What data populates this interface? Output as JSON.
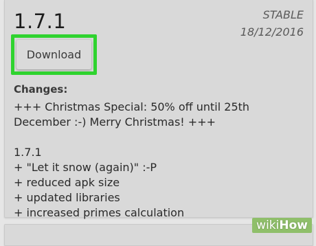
{
  "release": {
    "version": "1.7.1",
    "channel": "STABLE",
    "date": "18/12/2016",
    "download_label": "Download",
    "changes_heading": "Changes:",
    "notes": [
      "+++ Christmas Special: 50% off until 25th",
      "December :-) Merry Christmas! +++",
      "",
      "1.7.1",
      "+ \"Let it snow (again)\" :-P",
      "+ reduced apk size",
      "+ updated libraries",
      "+ increased primes calculation"
    ]
  },
  "watermark": {
    "wiki": "wiki",
    "how": "How"
  },
  "colors": {
    "highlight": "#2fd32f",
    "card_bg": "#d9d9d9",
    "page_bg": "#e6e6e6"
  }
}
